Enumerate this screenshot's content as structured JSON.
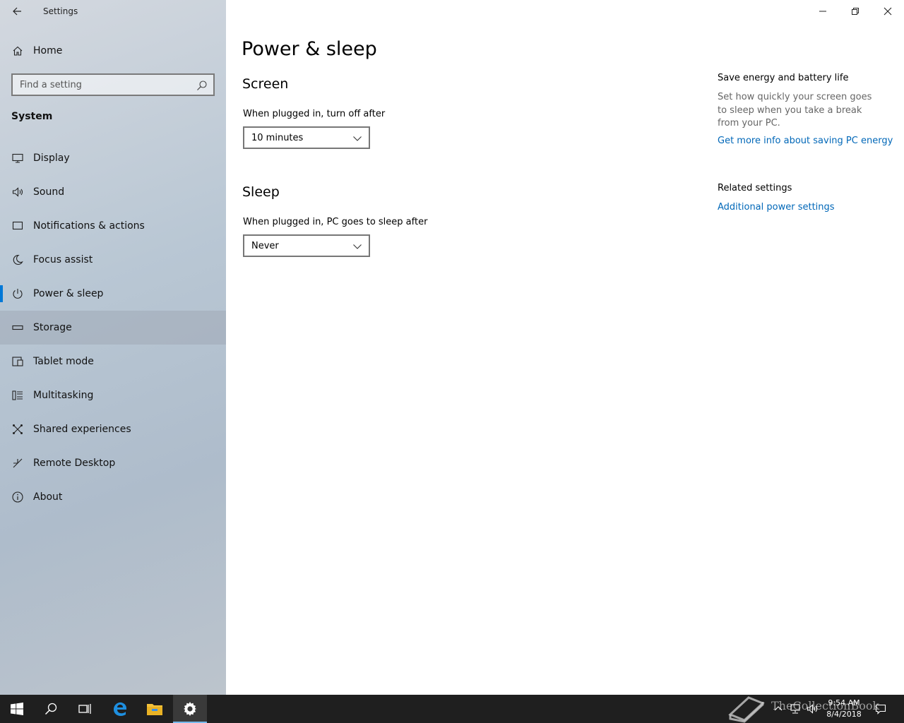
{
  "window": {
    "title": "Settings",
    "back_label": "Back",
    "controls": [
      "minimize",
      "restore",
      "close"
    ]
  },
  "sidebar": {
    "home_label": "Home",
    "search_placeholder": "Find a setting",
    "section_label": "System",
    "items": [
      {
        "label": "Display",
        "icon": "display-icon"
      },
      {
        "label": "Sound",
        "icon": "speaker-icon"
      },
      {
        "label": "Notifications & actions",
        "icon": "notification-icon"
      },
      {
        "label": "Focus assist",
        "icon": "moon-icon"
      },
      {
        "label": "Power & sleep",
        "icon": "power-icon",
        "selected": true
      },
      {
        "label": "Storage",
        "icon": "storage-icon",
        "hover": true
      },
      {
        "label": "Tablet mode",
        "icon": "tablet-icon"
      },
      {
        "label": "Multitasking",
        "icon": "multitasking-icon"
      },
      {
        "label": "Shared experiences",
        "icon": "shared-icon"
      },
      {
        "label": "Remote Desktop",
        "icon": "remote-desktop-icon"
      },
      {
        "label": "About",
        "icon": "info-icon"
      }
    ]
  },
  "main": {
    "title": "Power & sleep",
    "screen": {
      "heading": "Screen",
      "label": "When plugged in, turn off after",
      "value": "10 minutes"
    },
    "sleep": {
      "heading": "Sleep",
      "label": "When plugged in, PC goes to sleep after",
      "value": "Never"
    },
    "side": {
      "save_heading": "Save energy and battery life",
      "save_text": "Set how quickly your screen goes to sleep when you take a break from your PC.",
      "save_link": "Get more info about saving PC energy",
      "related_heading": "Related settings",
      "related_link": "Additional power settings"
    }
  },
  "taskbar": {
    "apps": [
      "windows-start-icon",
      "search-icon",
      "task-view-icon",
      "edge-icon",
      "file-explorer-icon",
      "settings-gear-icon"
    ],
    "active_app": "settings-gear-icon",
    "tray_icons": [
      "chevron-up-icon",
      "network-icon",
      "volume-icon",
      "action-center-icon"
    ],
    "time": "9:54 AM",
    "date": "8/4/2018",
    "watermark": "TheCollectionBook"
  },
  "colors": {
    "accent": "#0078d7",
    "link": "#0067b8",
    "taskbar": "#1f1f1f"
  }
}
